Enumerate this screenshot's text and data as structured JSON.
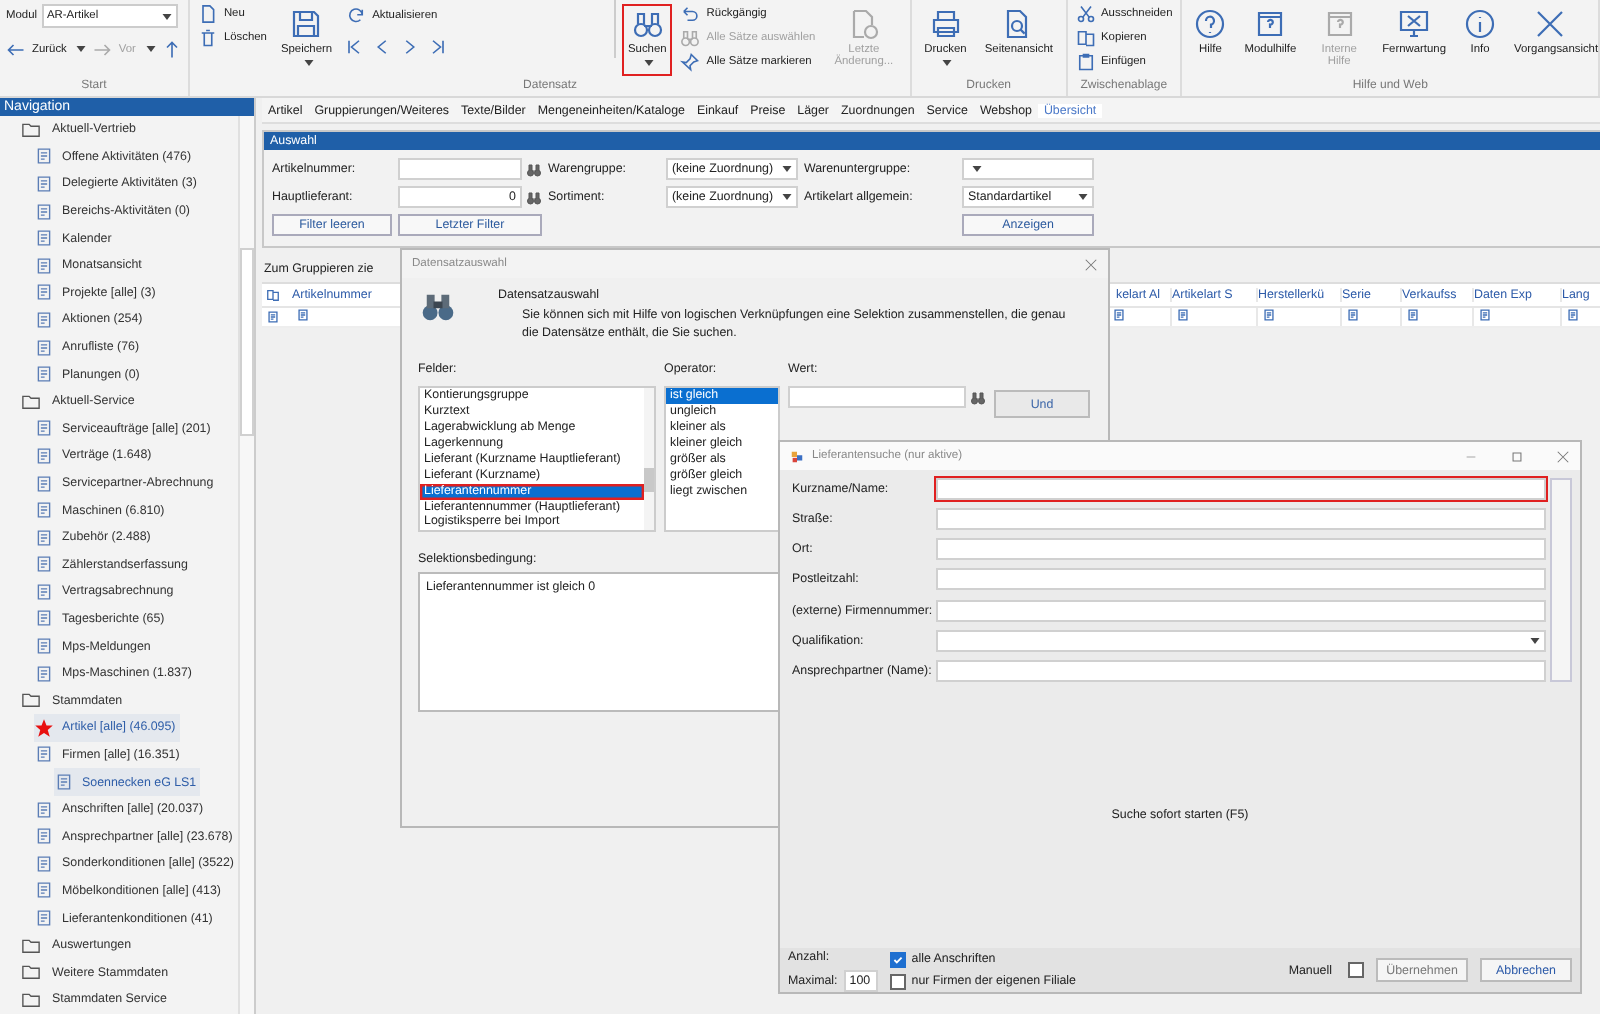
{
  "ribbon": {
    "start": {
      "label": "Start",
      "module_label": "Modul",
      "module_value": "AR-Artikel",
      "back": "Zurück",
      "forward": "Vor",
      "forward_disabled": true
    },
    "groups": [
      {
        "label": "Datensatz",
        "columns": [
          {
            "kind": "stack",
            "buttons": [
              {
                "text": "Neu",
                "disabled": false,
                "highlighted": false
              },
              {
                "text": "Löschen",
                "disabled": false,
                "highlighted": false
              }
            ]
          },
          {
            "kind": "large",
            "buttons": [
              {
                "text": "Speichern",
                "caret": true,
                "disabled": false,
                "highlighted": false
              }
            ]
          },
          {
            "kind": "nav",
            "buttons": [
              {
                "text": "Aktualisieren",
                "disabled": false,
                "highlighted": false
              }
            ]
          },
          {
            "kind": "large",
            "buttons": [
              {
                "text": "Suchen",
                "caret": true,
                "disabled": false,
                "highlighted": true
              }
            ]
          },
          {
            "kind": "stack",
            "buttons": [
              {
                "text": "Rückgängig",
                "disabled": false,
                "highlighted": false
              },
              {
                "text": "Alle Sätze auswählen",
                "disabled": true,
                "highlighted": false
              },
              {
                "text": "Alle Sätze markieren",
                "disabled": false,
                "highlighted": false
              }
            ]
          },
          {
            "kind": "large",
            "buttons": [
              {
                "text": "Letzte Änderung...",
                "caret": false,
                "disabled": true,
                "highlighted": false
              }
            ]
          }
        ]
      },
      {
        "label": "Drucken",
        "columns": [
          {
            "kind": "large",
            "buttons": [
              {
                "text": "Drucken",
                "caret": true,
                "disabled": false,
                "highlighted": false
              }
            ]
          },
          {
            "kind": "large",
            "buttons": [
              {
                "text": "Seitenansicht",
                "caret": false,
                "disabled": false,
                "highlighted": false
              }
            ]
          }
        ]
      },
      {
        "label": "Zwischenablage",
        "columns": [
          {
            "kind": "stack",
            "buttons": [
              {
                "text": "Ausschneiden",
                "disabled": false,
                "highlighted": false
              },
              {
                "text": "Kopieren",
                "disabled": false,
                "highlighted": false
              },
              {
                "text": "Einfügen",
                "disabled": false,
                "highlighted": false
              }
            ]
          }
        ]
      },
      {
        "label": "Hilfe und Web",
        "columns": [
          {
            "kind": "large",
            "buttons": [
              {
                "text": "Hilfe",
                "caret": false,
                "disabled": false,
                "highlighted": false
              }
            ]
          },
          {
            "kind": "large",
            "buttons": [
              {
                "text": "Modulhilfe",
                "caret": false,
                "disabled": false,
                "highlighted": false
              }
            ]
          },
          {
            "kind": "large",
            "buttons": [
              {
                "text": "Interne Hilfe",
                "caret": false,
                "disabled": true,
                "highlighted": false
              }
            ]
          },
          {
            "kind": "large",
            "buttons": [
              {
                "text": "Fernwartung",
                "caret": false,
                "disabled": false,
                "highlighted": false
              }
            ]
          },
          {
            "kind": "large",
            "buttons": [
              {
                "text": "Info",
                "caret": false,
                "disabled": false,
                "highlighted": false
              }
            ]
          },
          {
            "kind": "large",
            "buttons": [
              {
                "text": "Vorgangsansicht",
                "caret": false,
                "disabled": false,
                "highlighted": false
              }
            ]
          }
        ]
      }
    ]
  },
  "navigation": {
    "title": "Navigation",
    "items": [
      {
        "label": "Aktuell-Vertrieb",
        "selected": false,
        "children": [
          {
            "label": "Offene Aktivitäten (476)",
            "selected": false
          },
          {
            "label": "Delegierte Aktivitäten (3)",
            "selected": false
          },
          {
            "label": "Bereichs-Aktivitäten (0)",
            "selected": false
          },
          {
            "label": "Kalender",
            "selected": false
          },
          {
            "label": "Monatsansicht",
            "selected": false
          },
          {
            "label": "Projekte [alle] (3)",
            "selected": false
          },
          {
            "label": "Aktionen (254)",
            "selected": false
          },
          {
            "label": "Anrufliste (76)",
            "selected": false
          },
          {
            "label": "Planungen (0)",
            "selected": false
          }
        ]
      },
      {
        "label": "Aktuell-Service",
        "selected": false,
        "children": [
          {
            "label": "Serviceaufträge [alle] (201)",
            "selected": false
          },
          {
            "label": "Verträge (1.648)",
            "selected": false
          },
          {
            "label": "Servicepartner-Abrechnung",
            "selected": false
          },
          {
            "label": "Maschinen (6.810)",
            "selected": false
          },
          {
            "label": "Zubehör (2.488)",
            "selected": false
          },
          {
            "label": "Zählerstandserfassung",
            "selected": false
          },
          {
            "label": "Vertragsabrechnung",
            "selected": false
          },
          {
            "label": "Tagesberichte (65)",
            "selected": false
          },
          {
            "label": "Mps-Meldungen",
            "selected": false
          },
          {
            "label": "Mps-Maschinen (1.837)",
            "selected": false
          }
        ]
      },
      {
        "label": "Stammdaten",
        "selected": false,
        "children": [
          {
            "label": "Artikel [alle] (46.095)",
            "selected": true
          },
          {
            "label": "Firmen [alle] (16.351)",
            "selected": false,
            "children": [
              {
                "label": "Soennecken eG LS1",
                "selected": true
              }
            ]
          },
          {
            "label": "Anschriften [alle] (20.037)",
            "selected": false
          },
          {
            "label": "Ansprechpartner [alle] (23.678)",
            "selected": false
          },
          {
            "label": "Sonderkonditionen [alle] (3522)",
            "selected": false
          },
          {
            "label": "Möbelkonditionen [alle] (413)",
            "selected": false
          },
          {
            "label": "Lieferantenkonditionen (41)",
            "selected": false
          }
        ]
      },
      {
        "label": "Auswertungen",
        "selected": false
      },
      {
        "label": "Weitere Stammdaten",
        "selected": false
      },
      {
        "label": "Stammdaten Service",
        "selected": false
      }
    ]
  },
  "tabs": [
    {
      "label": "Artikel",
      "selected": false
    },
    {
      "label": "Gruppierungen/Weiteres",
      "selected": false
    },
    {
      "label": "Texte/Bilder",
      "selected": false
    },
    {
      "label": "Mengeneinheiten/Kataloge",
      "selected": false
    },
    {
      "label": "Einkauf",
      "selected": false
    },
    {
      "label": "Preise",
      "selected": false
    },
    {
      "label": "Läger",
      "selected": false
    },
    {
      "label": "Zuordnungen",
      "selected": false
    },
    {
      "label": "Service",
      "selected": false
    },
    {
      "label": "Webshop",
      "selected": false
    },
    {
      "label": "Übersicht",
      "selected": true
    }
  ],
  "filter": {
    "title": "Auswahl",
    "fields": [
      {
        "label": "Artikelnummer:",
        "kind": "lookup"
      },
      {
        "label": "Warengruppe:",
        "kind": "select",
        "value": "(keine Zuordnung)"
      },
      {
        "label": "Warenuntergruppe:",
        "kind": "select"
      },
      {
        "label": "Hauptlieferant:",
        "kind": "lookup",
        "value": "0"
      },
      {
        "label": "Sortiment:",
        "kind": "select",
        "value": "(keine Zuordnung)"
      },
      {
        "label": "Artikelart allgemein:",
        "kind": "select",
        "value": "Standardartikel"
      }
    ],
    "buttons": [
      "Filter leeren",
      "Letzter Filter",
      "Anzeigen"
    ]
  },
  "grid": {
    "group_hint": "Zum Gruppieren zie",
    "columns": [
      "Artikelnummer",
      "kelart Al",
      "Artikelart S",
      "Herstellerkü",
      "Serie",
      "Verkaufss",
      "Daten Exp",
      "Lang"
    ]
  },
  "record_selection": {
    "title": "Datensatzauswahl",
    "heading": "Datensatzauswahl",
    "description": "Sie können sich mit Hilfe von logischen Verknüpfungen eine Selektion zusammenstellen, die genau die Datensätze enthält, die Sie suchen.",
    "fields_label": "Felder:",
    "fields": [
      {
        "label": "Kontierungsgruppe",
        "selected": false,
        "highlighted": false
      },
      {
        "label": "Kurztext",
        "selected": false,
        "highlighted": false
      },
      {
        "label": "Lagerabwicklung ab Menge",
        "selected": false,
        "highlighted": false
      },
      {
        "label": "Lagerkennung",
        "selected": false,
        "highlighted": false
      },
      {
        "label": "Lieferant (Kurzname Hauptlieferant)",
        "selected": false,
        "highlighted": false
      },
      {
        "label": "Lieferant (Kurzname)",
        "selected": false,
        "highlighted": false
      },
      {
        "label": "Lieferantennummer",
        "selected": true,
        "highlighted": true
      },
      {
        "label": "Lieferantennummer (Hauptlieferant)",
        "selected": false,
        "highlighted": false
      },
      {
        "label": "Logistiksperre bei Import",
        "selected": false,
        "highlighted": false
      }
    ],
    "operator_label": "Operator:",
    "operators": [
      {
        "label": "ist gleich",
        "selected": true
      },
      {
        "label": "ungleich",
        "selected": false
      },
      {
        "label": "kleiner als",
        "selected": false
      },
      {
        "label": "kleiner gleich",
        "selected": false
      },
      {
        "label": "größer als",
        "selected": false
      },
      {
        "label": "größer gleich",
        "selected": false
      },
      {
        "label": "liegt zwischen",
        "selected": false
      }
    ],
    "value_label": "Wert:",
    "and_button": "Und",
    "condition_label": "Selektionsbedingung:",
    "condition": "Lieferantennummer ist gleich 0"
  },
  "supplier_search": {
    "title": "Lieferantensuche (nur aktive)",
    "fields": [
      {
        "label": "Kurzname/Name:",
        "kind": "text",
        "highlighted": true
      },
      {
        "label": "Straße:",
        "kind": "text",
        "highlighted": false
      },
      {
        "label": "Ort:",
        "kind": "text",
        "highlighted": false
      },
      {
        "label": "Postleitzahl:",
        "kind": "text",
        "highlighted": false
      },
      {
        "label": "(externe) Firmennummer:",
        "kind": "text",
        "highlighted": false
      },
      {
        "label": "Qualifikation:",
        "kind": "select",
        "highlighted": false
      },
      {
        "label": "Ansprechpartner (Name):",
        "kind": "text",
        "highlighted": false
      }
    ],
    "hint": "Suche sofort starten (F5)",
    "count_label": "Anzahl:",
    "max_label": "Maximal:",
    "max_value": "100",
    "options": [
      {
        "label": "alle Anschriften",
        "checked": true
      },
      {
        "label": "nur Firmen der eigenen Filiale",
        "checked": false
      }
    ],
    "manual_label": "Manuell",
    "manual_checked": false,
    "buttons": [
      {
        "label": "Übernehmen",
        "disabled": true
      },
      {
        "label": "Abbrechen",
        "disabled": false
      }
    ]
  }
}
